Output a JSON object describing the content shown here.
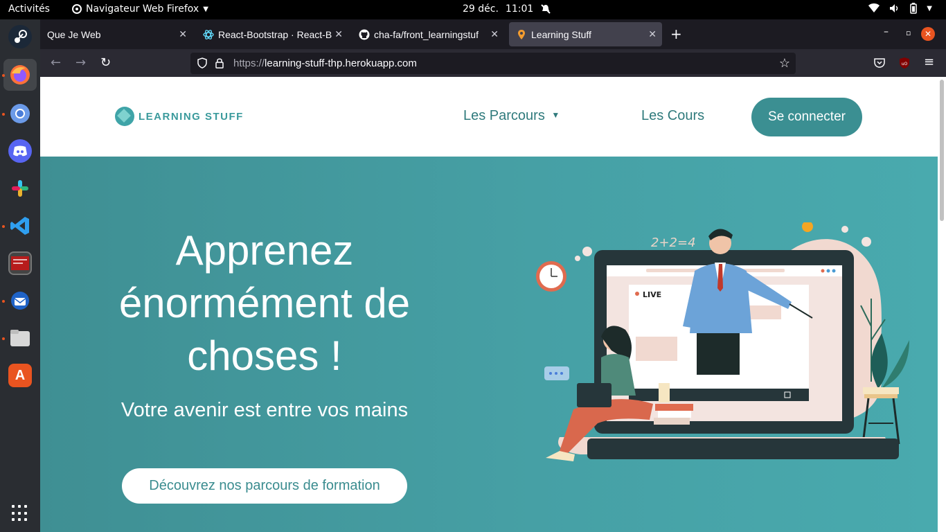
{
  "system": {
    "activities": "Activités",
    "app_name": "Navigateur Web Firefox",
    "date": "29 déc.",
    "time": "11:01"
  },
  "dock": {
    "apps": [
      "steam",
      "firefox",
      "chromium",
      "discord",
      "slack",
      "vscode",
      "terminal",
      "thunderbird",
      "files",
      "ubuntu-software"
    ]
  },
  "browser": {
    "tabs": [
      {
        "title": "Que Je Web"
      },
      {
        "title": "React-Bootstrap · React-B"
      },
      {
        "title": "cha-fa/front_learningstuf"
      },
      {
        "title": "Learning Stuff"
      }
    ],
    "url_protocol": "https://",
    "url_host": "learning-stuff-thp.herokuapp.com"
  },
  "site": {
    "logo_text": "LEARNING STUFF",
    "nav": {
      "parcours": "Les Parcours",
      "cours": "Les Cours",
      "login": "Se connecter"
    },
    "hero": {
      "title": "Apprenez énormément de choses !",
      "subtitle": "Votre avenir est entre vos mains",
      "cta": "Découvrez nos parcours de formation",
      "illus_equation": "2+2=4",
      "illus_live": "LIVE"
    }
  },
  "colors": {
    "brand": "#3b8f92",
    "hero_bg": "#46a0a5",
    "ubuntu_orange": "#e95420"
  }
}
